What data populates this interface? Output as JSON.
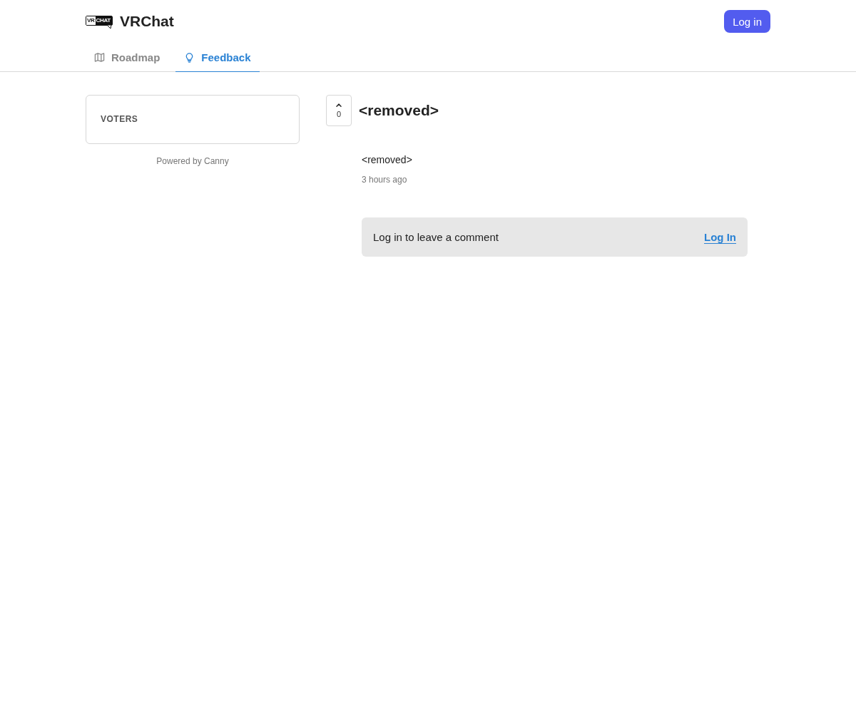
{
  "header": {
    "logo": {
      "left": "VR",
      "right": "CHAT"
    },
    "brand_name": "VRChat",
    "login_button": "Log in"
  },
  "tabs": [
    {
      "label": "Roadmap",
      "selected": false
    },
    {
      "label": "Feedback",
      "selected": true
    }
  ],
  "sidebar": {
    "voters_card": {
      "title": "VOTERS"
    },
    "powered_by": "Powered by Canny"
  },
  "post": {
    "vote_count": "0",
    "title": "<removed>",
    "body": "<removed>",
    "time": "3 hours ago",
    "comment_prompt": {
      "text": "Log in to leave a comment",
      "link": "Log In"
    }
  }
}
